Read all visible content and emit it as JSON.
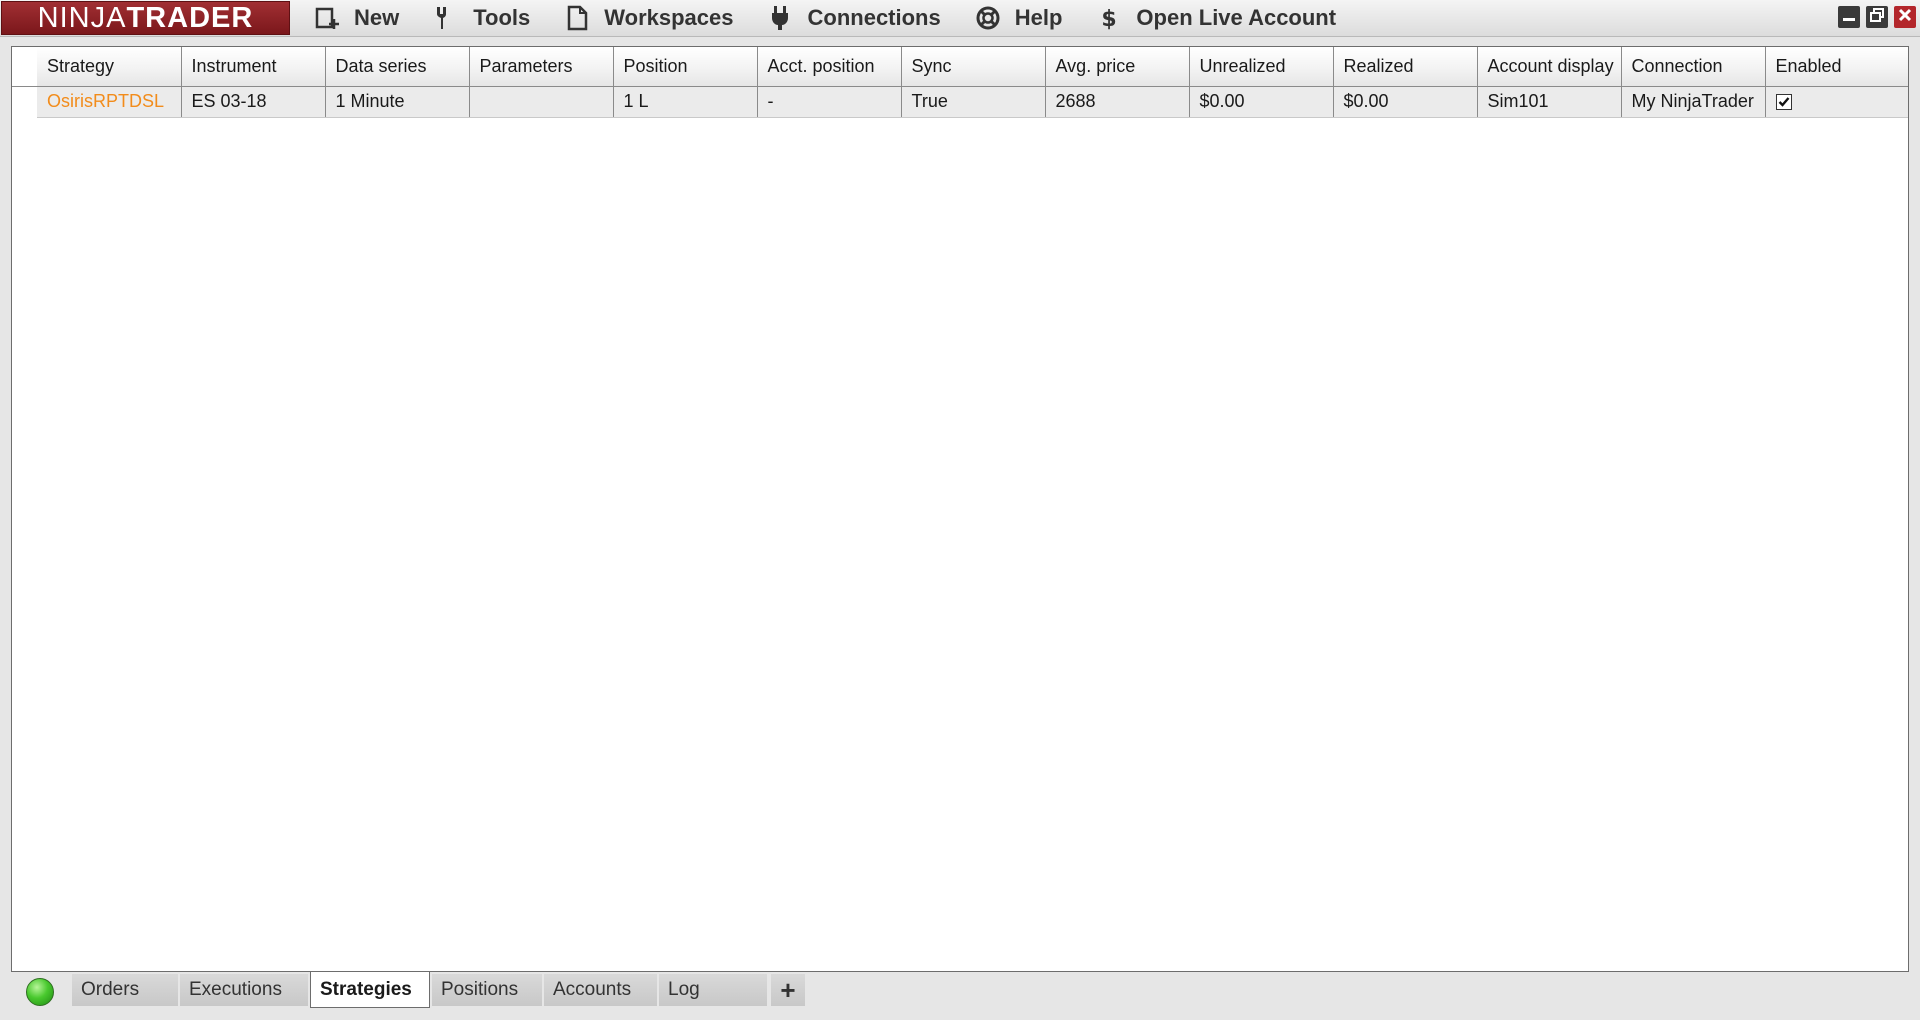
{
  "brand": {
    "name_thin": "NINJA",
    "name_bold": "TRADER",
    "accent": "#8e2226"
  },
  "menu": {
    "items": [
      {
        "label": "New",
        "icon": "new-window-icon"
      },
      {
        "label": "Tools",
        "icon": "wrench-icon"
      },
      {
        "label": "Workspaces",
        "icon": "document-icon"
      },
      {
        "label": "Connections",
        "icon": "plug-icon"
      },
      {
        "label": "Help",
        "icon": "lifebuoy-icon"
      },
      {
        "label": "Open Live Account",
        "icon": "dollar-icon"
      }
    ]
  },
  "window_controls": {
    "minimize": "minimize-icon",
    "restore": "restore-icon",
    "close": "close-icon"
  },
  "grid": {
    "columns": [
      "Strategy",
      "Instrument",
      "Data series",
      "Parameters",
      "Position",
      "Acct. position",
      "Sync",
      "Avg. price",
      "Unrealized",
      "Realized",
      "Account display",
      "Connection",
      "Enabled"
    ],
    "rows": [
      {
        "strategy": "OsirisRPTDSL",
        "instrument": "ES 03-18",
        "data_series": "1 Minute",
        "parameters": "",
        "position": "1 L",
        "acct_position": "-",
        "sync": "True",
        "avg_price": "2688",
        "unrealized": "$0.00",
        "realized": "$0.00",
        "account_display": "Sim101",
        "connection": "My NinjaTrader",
        "enabled": true
      }
    ],
    "strategy_color": "#f28c1b"
  },
  "tabs": {
    "status": "connected",
    "status_color": "#49c92e",
    "items": [
      {
        "label": "Orders",
        "active": false
      },
      {
        "label": "Executions",
        "active": false
      },
      {
        "label": "Strategies",
        "active": true
      },
      {
        "label": "Positions",
        "active": false
      },
      {
        "label": "Accounts",
        "active": false
      },
      {
        "label": "Log",
        "active": false
      }
    ],
    "add_label": "+"
  }
}
